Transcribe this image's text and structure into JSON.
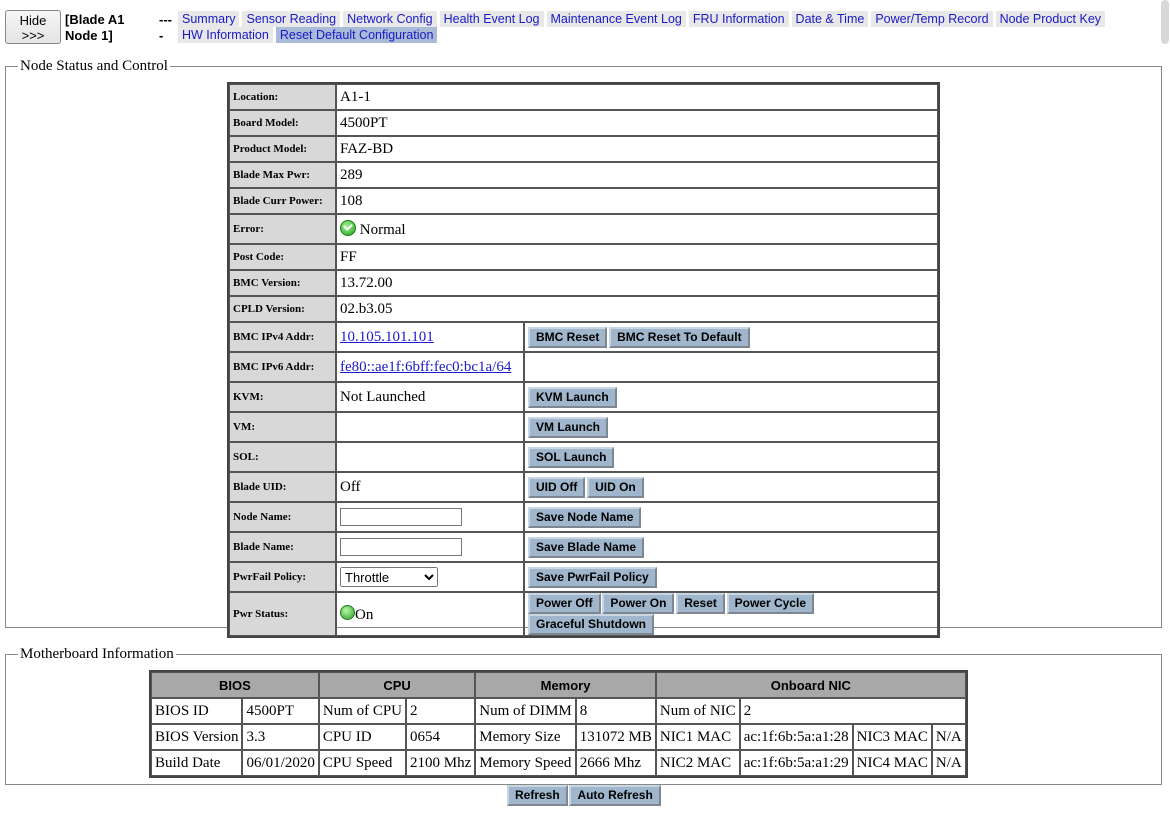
{
  "top": {
    "hide_button": "Hide\n>>>",
    "blade_line1": "[Blade A1",
    "blade_line2": "Node 1]",
    "dash1": "---",
    "dash2": "-",
    "nav": [
      "Summary",
      "Sensor Reading",
      "Network Config",
      "Health Event Log",
      "Maintenance Event Log",
      "FRU Information",
      "Date & Time",
      "Power/Temp Record",
      "Node Product Key",
      "HW Information",
      "Reset Default Configuration"
    ],
    "active_nav": "Reset Default Configuration"
  },
  "status": {
    "legend": "Node Status and Control",
    "rows": {
      "location": {
        "label": "Location:",
        "value": "A1-1"
      },
      "board_model": {
        "label": "Board Model:",
        "value": "4500PT"
      },
      "product_model": {
        "label": "Product Model:",
        "value": "FAZ-BD"
      },
      "max_pwr": {
        "label": "Blade Max Pwr:",
        "value": "289"
      },
      "curr_pwr": {
        "label": "Blade Curr Power:",
        "value": "108"
      },
      "error": {
        "label": "Error:",
        "value": "Normal"
      },
      "post_code": {
        "label": "Post Code:",
        "value": "FF"
      },
      "bmc_version": {
        "label": "BMC Version:",
        "value": "13.72.00"
      },
      "cpld_version": {
        "label": "CPLD Version:",
        "value": "02.b3.05"
      },
      "ipv4": {
        "label": "BMC IPv4 Addr:",
        "value": "10.105.101.101"
      },
      "ipv6": {
        "label": "BMC IPv6 Addr:",
        "value": "fe80::ae1f:6bff:fec0:bc1a/64"
      },
      "kvm": {
        "label": "KVM:",
        "value": "Not Launched"
      },
      "vm": {
        "label": "VM:",
        "value": ""
      },
      "sol": {
        "label": "SOL:",
        "value": ""
      },
      "uid": {
        "label": "Blade UID:",
        "value": "Off"
      },
      "node_name": {
        "label": "Node Name:",
        "value": ""
      },
      "blade_name": {
        "label": "Blade Name:",
        "value": ""
      },
      "pwrfail": {
        "label": "PwrFail Policy:",
        "value": "Throttle"
      },
      "pwr_status": {
        "label": "Pwr Status:",
        "value": "On"
      }
    },
    "buttons": {
      "bmc_reset": "BMC Reset",
      "bmc_reset_default": "BMC Reset To Default",
      "kvm_launch": "KVM Launch",
      "vm_launch": "VM Launch",
      "sol_launch": "SOL Launch",
      "uid_off": "UID Off",
      "uid_on": "UID On",
      "save_node": "Save Node Name",
      "save_blade": "Save Blade Name",
      "save_pwrfail": "Save PwrFail Policy",
      "power_off": "Power Off",
      "power_on": "Power On",
      "reset": "Reset",
      "power_cycle": "Power Cycle",
      "graceful": "Graceful Shutdown"
    },
    "icons": {
      "error": "ok-check-icon",
      "power": "power-on-icon"
    }
  },
  "mb": {
    "legend": "Motherboard Information",
    "headers": {
      "bios": "BIOS",
      "cpu": "CPU",
      "memory": "Memory",
      "nic": "Onboard NIC"
    },
    "r1": [
      "BIOS ID",
      "4500PT",
      "Num of CPU",
      "2",
      "Num of DIMM",
      "8",
      "Num of NIC",
      "2"
    ],
    "r2": [
      "BIOS Version",
      "3.3",
      "CPU ID",
      "0654",
      "Memory Size",
      "131072 MB",
      "NIC1 MAC",
      "ac:1f:6b:5a:a1:28",
      "NIC3 MAC",
      "N/A"
    ],
    "r3": [
      "Build Date",
      "06/01/2020",
      "CPU Speed",
      "2100 Mhz",
      "Memory Speed",
      "2666 Mhz",
      "NIC2 MAC",
      "ac:1f:6b:5a:a1:29",
      "NIC4 MAC",
      "N/A"
    ]
  },
  "bottom": {
    "refresh": "Refresh",
    "auto_refresh": "Auto Refresh"
  }
}
